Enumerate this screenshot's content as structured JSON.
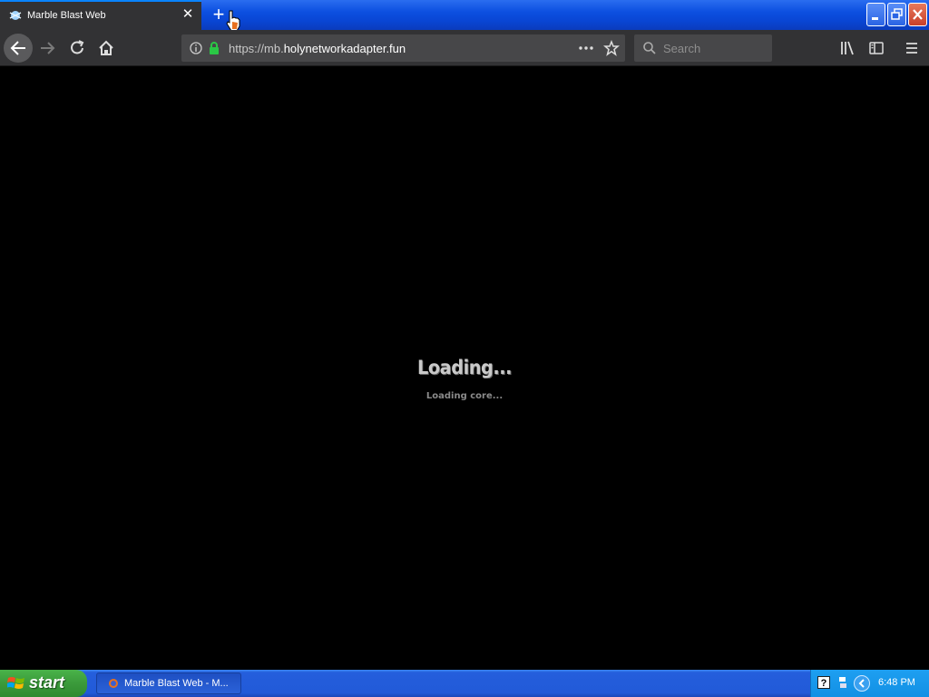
{
  "window": {
    "tab_title": "Marble Blast Web",
    "tab_close": "✕",
    "new_tab": "+"
  },
  "nav": {
    "url_prefix": "https://mb.",
    "url_domain": "holynetworkadapter.fun",
    "search_placeholder": "Search"
  },
  "content": {
    "loading_title": "Loading...",
    "loading_status": "Loading core..."
  },
  "taskbar": {
    "start_label": "start",
    "task_label": "Marble Blast Web - M...",
    "tray_help": "?",
    "clock": "6:48 PM"
  },
  "colors": {
    "accent": "#0a84ff",
    "lock_green": "#2ac845"
  }
}
